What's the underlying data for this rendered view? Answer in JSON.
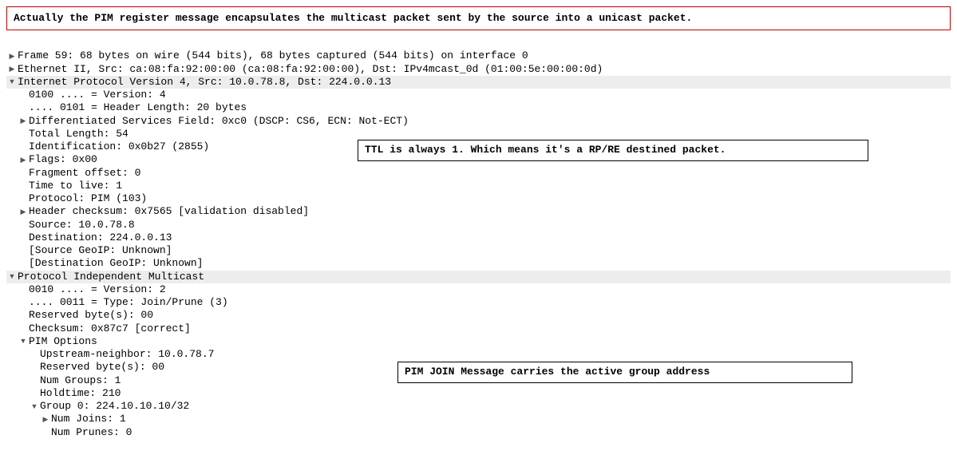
{
  "topnote": "Actually the PIM register message encapsulates the multicast packet sent by the source into a unicast packet.",
  "callouts": {
    "ttl": "TTL is always 1. Which means it's a RP/RE destined packet.",
    "pimjoin": "PIM JOIN Message carries the active group address"
  },
  "frame": "Frame 59: 68 bytes on wire (544 bits), 68 bytes captured (544 bits) on interface 0",
  "eth": "Ethernet II, Src: ca:08:fa:92:00:00 (ca:08:fa:92:00:00), Dst: IPv4mcast_0d (01:00:5e:00:00:0d)",
  "ip": {
    "header": "Internet Protocol Version 4, Src: 10.0.78.8, Dst: 224.0.0.13",
    "version": "0100 .... = Version: 4",
    "hlen": ".... 0101 = Header Length: 20 bytes",
    "dsfield": "Differentiated Services Field: 0xc0 (DSCP: CS6, ECN: Not-ECT)",
    "tlen": "Total Length: 54",
    "ident": "Identification: 0x0b27 (2855)",
    "flags": "Flags: 0x00",
    "fragoff": "Fragment offset: 0",
    "ttl": "Time to live: 1",
    "proto": "Protocol: PIM (103)",
    "cksum": "Header checksum: 0x7565 [validation disabled]",
    "src": "Source: 10.0.78.8",
    "dst": "Destination: 224.0.0.13",
    "srcgeo": "[Source GeoIP: Unknown]",
    "dstgeo": "[Destination GeoIP: Unknown]"
  },
  "pim": {
    "header": "Protocol Independent Multicast",
    "version": "0010 .... = Version: 2",
    "type": ".... 0011 = Type: Join/Prune (3)",
    "reserved": "Reserved byte(s): 00",
    "cksum": "Checksum: 0x87c7 [correct]",
    "options": {
      "header": "PIM Options",
      "upstream": "Upstream-neighbor: 10.0.78.7",
      "reserved": "Reserved byte(s): 00",
      "numgroups": "Num Groups: 1",
      "holdtime": "Holdtime: 210",
      "group0": {
        "header": "Group 0: 224.10.10.10/32",
        "numjoins": "Num Joins: 1",
        "numprunes": "Num Prunes: 0"
      }
    }
  },
  "glyphs": {
    "right": "▶",
    "down": "▼"
  }
}
